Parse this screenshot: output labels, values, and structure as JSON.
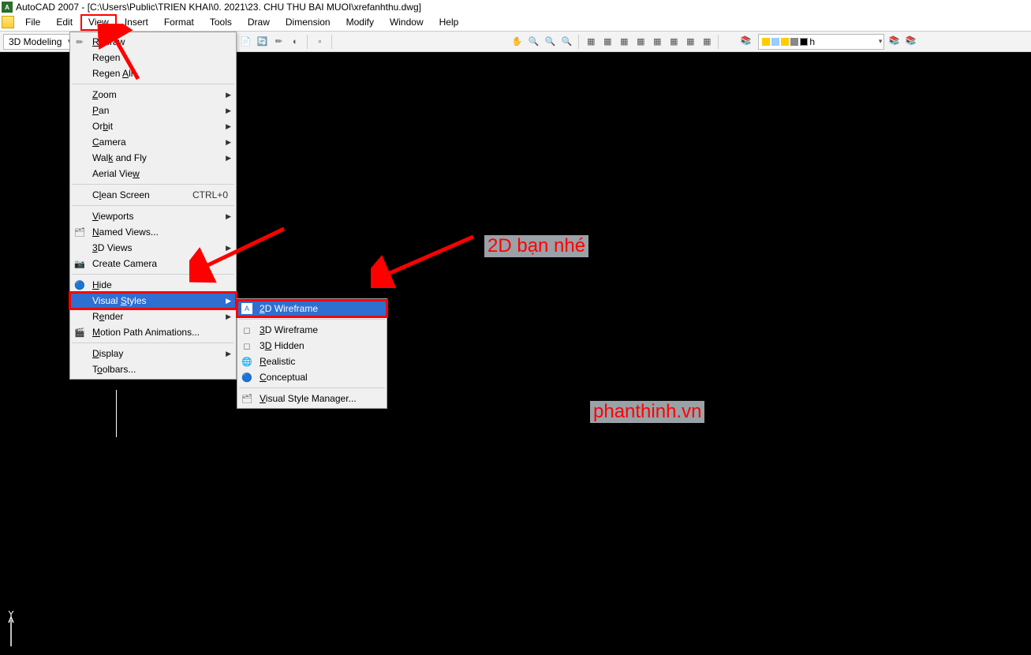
{
  "title": "AutoCAD 2007 - [C:\\Users\\Public\\TRIEN KHAI\\0. 2021\\23. CHU THU BAI MUOI\\xrefanhthu.dwg]",
  "menubar": {
    "file": "File",
    "edit": "Edit",
    "view": "View",
    "insert": "Insert",
    "format": "Format",
    "tools": "Tools",
    "draw": "Draw",
    "dimension": "Dimension",
    "modify": "Modify",
    "window": "Window",
    "help": "Help"
  },
  "workspace": "3D Modeling",
  "layer_current": "h",
  "view_menu": {
    "redraw": "Redraw",
    "regen": "Regen",
    "regen_all": "Regen All",
    "zoom": "Zoom",
    "pan": "Pan",
    "orbit": "Orbit",
    "camera": "Camera",
    "walk_fly": "Walk and Fly",
    "aerial": "Aerial View",
    "clean": "Clean Screen",
    "clean_sc": "CTRL+0",
    "viewports": "Viewports",
    "named": "Named Views...",
    "views3d": "3D Views",
    "create_cam": "Create Camera",
    "hide": "Hide",
    "visual_styles": "Visual Styles",
    "render": "Render",
    "motion": "Motion Path Animations...",
    "display": "Display",
    "toolbars": "Toolbars..."
  },
  "vs_submenu": {
    "wf2d": "2D Wireframe",
    "wf3d": "3D Wireframe",
    "hidden3d": "3D Hidden",
    "realistic": "Realistic",
    "conceptual": "Conceptual",
    "manager": "Visual Style Manager..."
  },
  "annotations": {
    "hint": "2D bạn nhé",
    "watermark": "phanthinh.vn"
  }
}
